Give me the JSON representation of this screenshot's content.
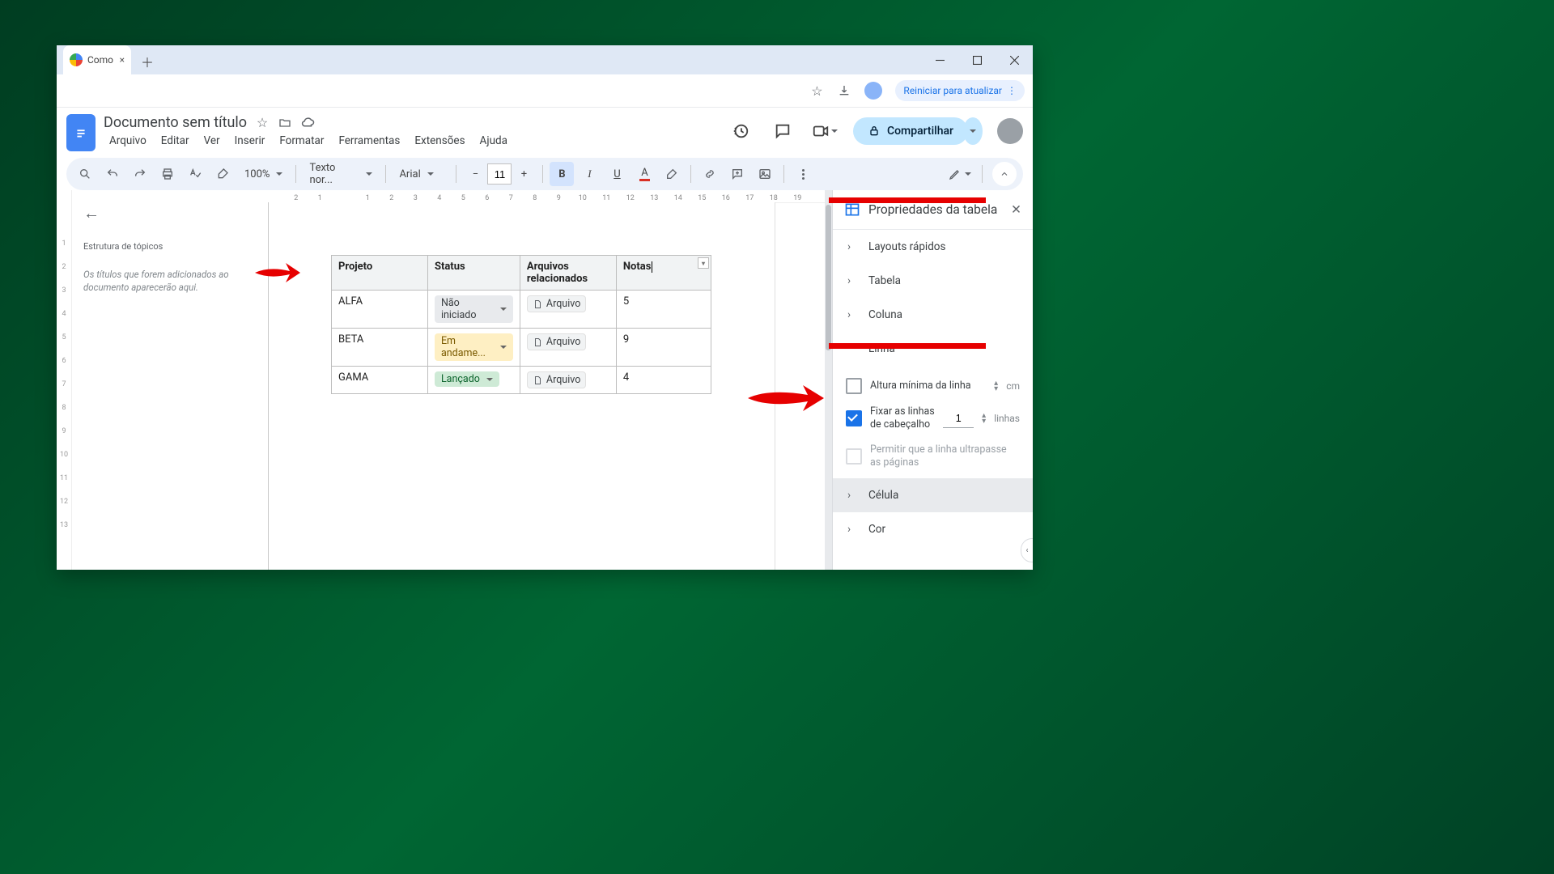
{
  "browser": {
    "tab_title": "Como",
    "restart_label": "Reiniciar para atualizar"
  },
  "doc": {
    "title": "Documento sem título",
    "menus": [
      "Arquivo",
      "Editar",
      "Ver",
      "Inserir",
      "Formatar",
      "Ferramentas",
      "Extensões",
      "Ajuda"
    ],
    "share_label": "Compartilhar"
  },
  "toolbar": {
    "zoom": "100%",
    "style": "Texto nor...",
    "font": "Arial",
    "font_size": "11"
  },
  "outline": {
    "title": "Estrutura de tópicos",
    "hint": "Os títulos que forem adicionados ao documento aparecerão aqui."
  },
  "hruler": [
    "2",
    "1",
    "",
    "1",
    "2",
    "3",
    "4",
    "5",
    "6",
    "7",
    "8",
    "9",
    "10",
    "11",
    "12",
    "13",
    "14",
    "15",
    "16",
    "17",
    "18",
    "19"
  ],
  "vruler": [
    "",
    "1",
    "2",
    "3",
    "4",
    "5",
    "6",
    "7",
    "8",
    "9",
    "10",
    "11",
    "12",
    "13"
  ],
  "table": {
    "headers": [
      "Projeto",
      "Status",
      "Arquivos relacionados",
      "Notas"
    ],
    "rows": [
      {
        "projeto": "ALFA",
        "status": "Não iniciado",
        "status_class": "chip-grey",
        "arquivo": "Arquivo",
        "notas": "5"
      },
      {
        "projeto": "BETA",
        "status": "Em andame...",
        "status_class": "chip-yellow",
        "arquivo": "Arquivo",
        "notas": "9"
      },
      {
        "projeto": "GAMA",
        "status": "Lançado",
        "status_class": "chip-green",
        "arquivo": "Arquivo",
        "notas": "4"
      }
    ]
  },
  "sidepanel": {
    "title": "Propriedades da tabela",
    "sections": {
      "quick_layouts": "Layouts rápidos",
      "table": "Tabela",
      "column": "Coluna",
      "row": "Linha",
      "cell": "Célula",
      "color": "Cor"
    },
    "row_options": {
      "min_height": "Altura mínima da linha",
      "min_height_unit": "cm",
      "pin_header": "Fixar as linhas de cabeçalho",
      "pin_header_value": "1",
      "pin_header_unit": "linhas",
      "allow_overflow": "Permitir que a linha ultrapasse as páginas"
    }
  }
}
